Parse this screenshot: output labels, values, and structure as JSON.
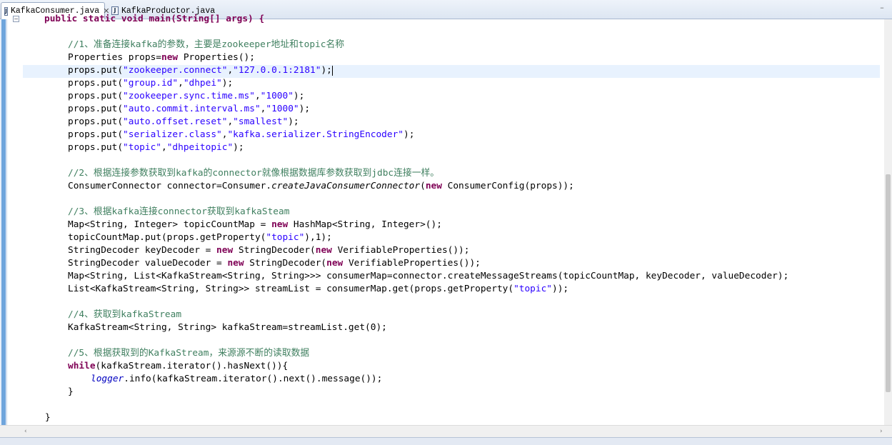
{
  "tabs": [
    {
      "label": "KafkaConsumer.java",
      "active": true
    },
    {
      "label": "KafkaProductor.java",
      "active": false
    }
  ],
  "icons": {
    "file": "java-file-icon",
    "close": "close-icon",
    "minimize": "minimize-icon"
  },
  "colors": {
    "keyword": "#7f0055",
    "string": "#2a00ff",
    "comment": "#3f7f5f",
    "field": "#0000c0"
  },
  "code": {
    "line_main": "public static void main(String[] args) {",
    "c1": "//1、准备连接kafka的参数，主要是zookeeper地址和topic名称",
    "l_props_decl_a": " props=",
    "l_props_type": "Properties",
    "l_props_new": "new",
    "l_props_ctor": " Properties();",
    "put_prefix": "props.put(",
    "put_comma": ",",
    "put_suffix": ");",
    "kv": [
      {
        "k": "\"zookeeper.connect\"",
        "v": "\"127.0.0.1:2181\""
      },
      {
        "k": "\"group.id\"",
        "v": "\"dhpei\""
      },
      {
        "k": "\"zookeeper.sync.time.ms\"",
        "v": "\"1000\""
      },
      {
        "k": "\"auto.commit.interval.ms\"",
        "v": "\"1000\""
      },
      {
        "k": "\"auto.offset.reset\"",
        "v": "\"smallest\""
      },
      {
        "k": "\"serializer.class\"",
        "v": "\"kafka.serializer.StringEncoder\""
      },
      {
        "k": "\"topic\"",
        "v": "\"dhpeitopic\""
      }
    ],
    "c2": "//2、根据连接参数获取到kafka的connector就像根据数据库参数获取到jdbc连接一样。",
    "l_conn_a": "ConsumerConnector connector=Consumer.",
    "l_conn_method": "createJavaConsumerConnector",
    "l_conn_b": "(",
    "l_conn_new": "new",
    "l_conn_c": " ConsumerConfig(props));",
    "c3": "//3、根据kafka连接connector获取到kafkaSteam",
    "l_map_a": "Map<String, Integer> topicCountMap = ",
    "l_map_new": "new",
    "l_map_b": " HashMap<String, Integer>();",
    "l_tcm_a": "topicCountMap.put(props.getProperty(",
    "l_tcm_str": "\"topic\"",
    "l_tcm_b": "),1);",
    "l_kd_a": "StringDecoder keyDecoder = ",
    "l_kd_new1": "new",
    "l_kd_b": " StringDecoder(",
    "l_kd_new2": "new",
    "l_kd_c": " VerifiableProperties());",
    "l_vd_a": "StringDecoder valueDecoder = ",
    "l_vd_new1": "new",
    "l_vd_b": " StringDecoder(",
    "l_vd_new2": "new",
    "l_vd_c": " VerifiableProperties());",
    "l_cm": "Map<String, List<KafkaStream<String, String>>> consumerMap=connector.createMessageStreams(topicCountMap, keyDecoder, valueDecoder);",
    "l_sl_a": "List<KafkaStream<String, String>> streamList = consumerMap.get(props.getProperty(",
    "l_sl_str": "\"topic\"",
    "l_sl_b": "));",
    "c4": "//4、获取到kafkaStream",
    "l_ks": "KafkaStream<String, String> kafkaStream=streamList.get(0);",
    "c5": "//5、根据获取到的KafkaStream，来源源不断的读取数据",
    "l_while_kw": "while",
    "l_while_b": "(kafkaStream.iterator().hasNext()){",
    "l_logger": "logger",
    "l_logger_b": ".info(kafkaStream.iterator().next().message());",
    "l_close_inner": "}",
    "l_close_outer": "}"
  }
}
